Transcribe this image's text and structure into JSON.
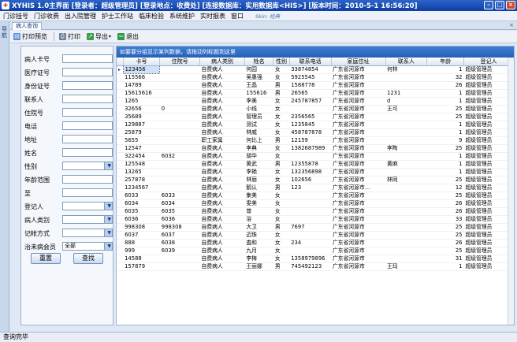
{
  "title_bar": {
    "title": "XYHIS 1.0主界面   [登录者：超级管理员]  [登录地点：收费处]  [连接数据库：实用数据库<HIS>]  [版本时间：2010-5-1 16:56:20]"
  },
  "menu": {
    "items": [
      "门诊挂号",
      "门诊收费",
      "出入院管理",
      "护士工作站",
      "临床检验",
      "系统维护",
      "实时报表",
      "窗口"
    ],
    "skin_label": "Skin: 经典"
  },
  "left_strip_label": "导航",
  "tab": {
    "label": "病人查询"
  },
  "toolbar": {
    "print_preview": "打印预览",
    "print": "打印",
    "export": "导出",
    "exit": "退出"
  },
  "query": {
    "fields": [
      {
        "label": "病人卡号",
        "value": ""
      },
      {
        "label": "医疗证号",
        "value": ""
      },
      {
        "label": "身份证号",
        "value": ""
      },
      {
        "label": "联系人",
        "value": ""
      },
      {
        "label": "住院号",
        "value": ""
      },
      {
        "label": "电话",
        "value": ""
      },
      {
        "label": "地址",
        "value": ""
      },
      {
        "label": "姓名",
        "value": ""
      },
      {
        "label": "性别",
        "value": ""
      },
      {
        "label": "年龄范围",
        "value": ""
      },
      {
        "label": "至",
        "value": ""
      },
      {
        "label": "登记人",
        "value": ""
      },
      {
        "label": "病人类别",
        "value": ""
      },
      {
        "label": "记帐方式",
        "value": ""
      },
      {
        "label": "治未病会员",
        "value": "全部"
      }
    ],
    "reset_button": "重置",
    "search_button": "查找"
  },
  "grid": {
    "group_hint": "如要要分组显示某列数据，请拖动列标题到这里",
    "columns": [
      "卡号",
      "住院号",
      "病人类别",
      "姓名",
      "性别",
      "联系电话",
      "家庭住址",
      "联系人",
      "年龄",
      "登记人"
    ],
    "rows": [
      [
        "123456",
        "",
        "自费病人",
        "何园",
        "女",
        "33874854",
        "广东省河源市",
        "何林",
        "1",
        "超级管理员"
      ],
      [
        "115566",
        "",
        "自费病人",
        "吴惠强",
        "女",
        "5925545",
        "广东省河源市",
        "",
        "32",
        "超级管理员"
      ],
      [
        "14789",
        "",
        "自费病人",
        "王晶",
        "男",
        "1588778",
        "广东省河源市",
        "",
        "26",
        "超级管理员"
      ],
      [
        "15615616",
        "",
        "自费病人",
        "155616",
        "男",
        "26565",
        "广东省河源市",
        "1231",
        "1",
        "超级管理员"
      ],
      [
        "1265",
        "",
        "自费病人",
        "李美",
        "女",
        "245787857",
        "广东省河源市",
        "d",
        "1",
        "超级管理员"
      ],
      [
        "32656",
        "0",
        "自费病人",
        "小线",
        "女",
        "",
        "广东省河源市",
        "王可",
        "25",
        "超级管理员"
      ],
      [
        "35689",
        "",
        "自费病人",
        "管理员",
        "女",
        "2356565",
        "广东省河源市",
        "",
        "25",
        "超级管理员"
      ],
      [
        "129887",
        "",
        "自费病人",
        "测试",
        "女",
        "1235845",
        "广东省河源市",
        "",
        "1",
        "超级管理员"
      ],
      [
        "25879",
        "",
        "自费病人",
        "林威",
        "女",
        "458787878",
        "广东省河源市",
        "",
        "1",
        "超级管理员"
      ],
      [
        "5655",
        "",
        "职工家属",
        "何比上",
        "男",
        "12159",
        "广东省河源市",
        "",
        "9",
        "超级管理员"
      ],
      [
        "12547",
        "",
        "自费病人",
        "李典",
        "女",
        "1382687989",
        "广东省河源市",
        "李陶",
        "25",
        "超级管理员"
      ],
      [
        "322454",
        "6032",
        "自费病人",
        "胡华",
        "女",
        "",
        "广东省河源市",
        "",
        "1",
        "超级管理员"
      ],
      [
        "125548",
        "",
        "自费病人",
        "黄武",
        "男",
        "12355878",
        "广东省河源市",
        "黄麻",
        "1",
        "超级管理员"
      ],
      [
        "13265",
        "",
        "自费病人",
        "李艳",
        "女",
        "132356898",
        "广东省河源市",
        "",
        "1",
        "超级管理员"
      ],
      [
        "257878",
        "",
        "自费病人",
        "林丽",
        "女",
        "102656",
        "广东省河源市",
        "林同",
        "25",
        "超级管理员"
      ],
      [
        "1234567",
        "",
        "自费病人",
        "鹅认",
        "男",
        "123",
        "广东省河源市...",
        "",
        "12",
        "超级管理员"
      ],
      [
        "6033",
        "6033",
        "自费病人",
        "集美",
        "女",
        "",
        "广东省河源市",
        "",
        "25",
        "超级管理员"
      ],
      [
        "6034",
        "6034",
        "自费病人",
        "雯美",
        "女",
        "",
        "广东省河源市",
        "",
        "26",
        "超级管理员"
      ],
      [
        "6035",
        "6035",
        "自费病人",
        "尊",
        "女",
        "",
        "广东省河源市",
        "",
        "26",
        "超级管理员"
      ],
      [
        "6036",
        "6036",
        "自费病人",
        "浴",
        "女",
        "",
        "广东省河源市",
        "",
        "33",
        "超级管理员"
      ],
      [
        "998308",
        "998308",
        "自费病人",
        "大卫",
        "男",
        "7697",
        "广东省河源市",
        "",
        "25",
        "超级管理员"
      ],
      [
        "6037",
        "6037",
        "自费病人",
        "迈珠",
        "女",
        "",
        "广东省河源市",
        "",
        "25",
        "超级管理员"
      ],
      [
        "888",
        "6038",
        "自费病人",
        "査和",
        "女",
        "234",
        "广东省河源市",
        "",
        "26",
        "超级管理员"
      ],
      [
        "999",
        "6039",
        "自费病人",
        "九月",
        "女",
        "",
        "广东省河源市",
        "",
        "25",
        "超级管理员"
      ],
      [
        "14588",
        "",
        "自费病人",
        "李梅",
        "女",
        "1358979896",
        "广东省河源市",
        "",
        "31",
        "超级管理员"
      ],
      [
        "157879",
        "",
        "自费病人",
        "王丽娜",
        "男",
        "745492123",
        "广东省河源市",
        "王玛",
        "1",
        "超级管理员"
      ]
    ]
  },
  "status": {
    "text": "查询完毕"
  }
}
